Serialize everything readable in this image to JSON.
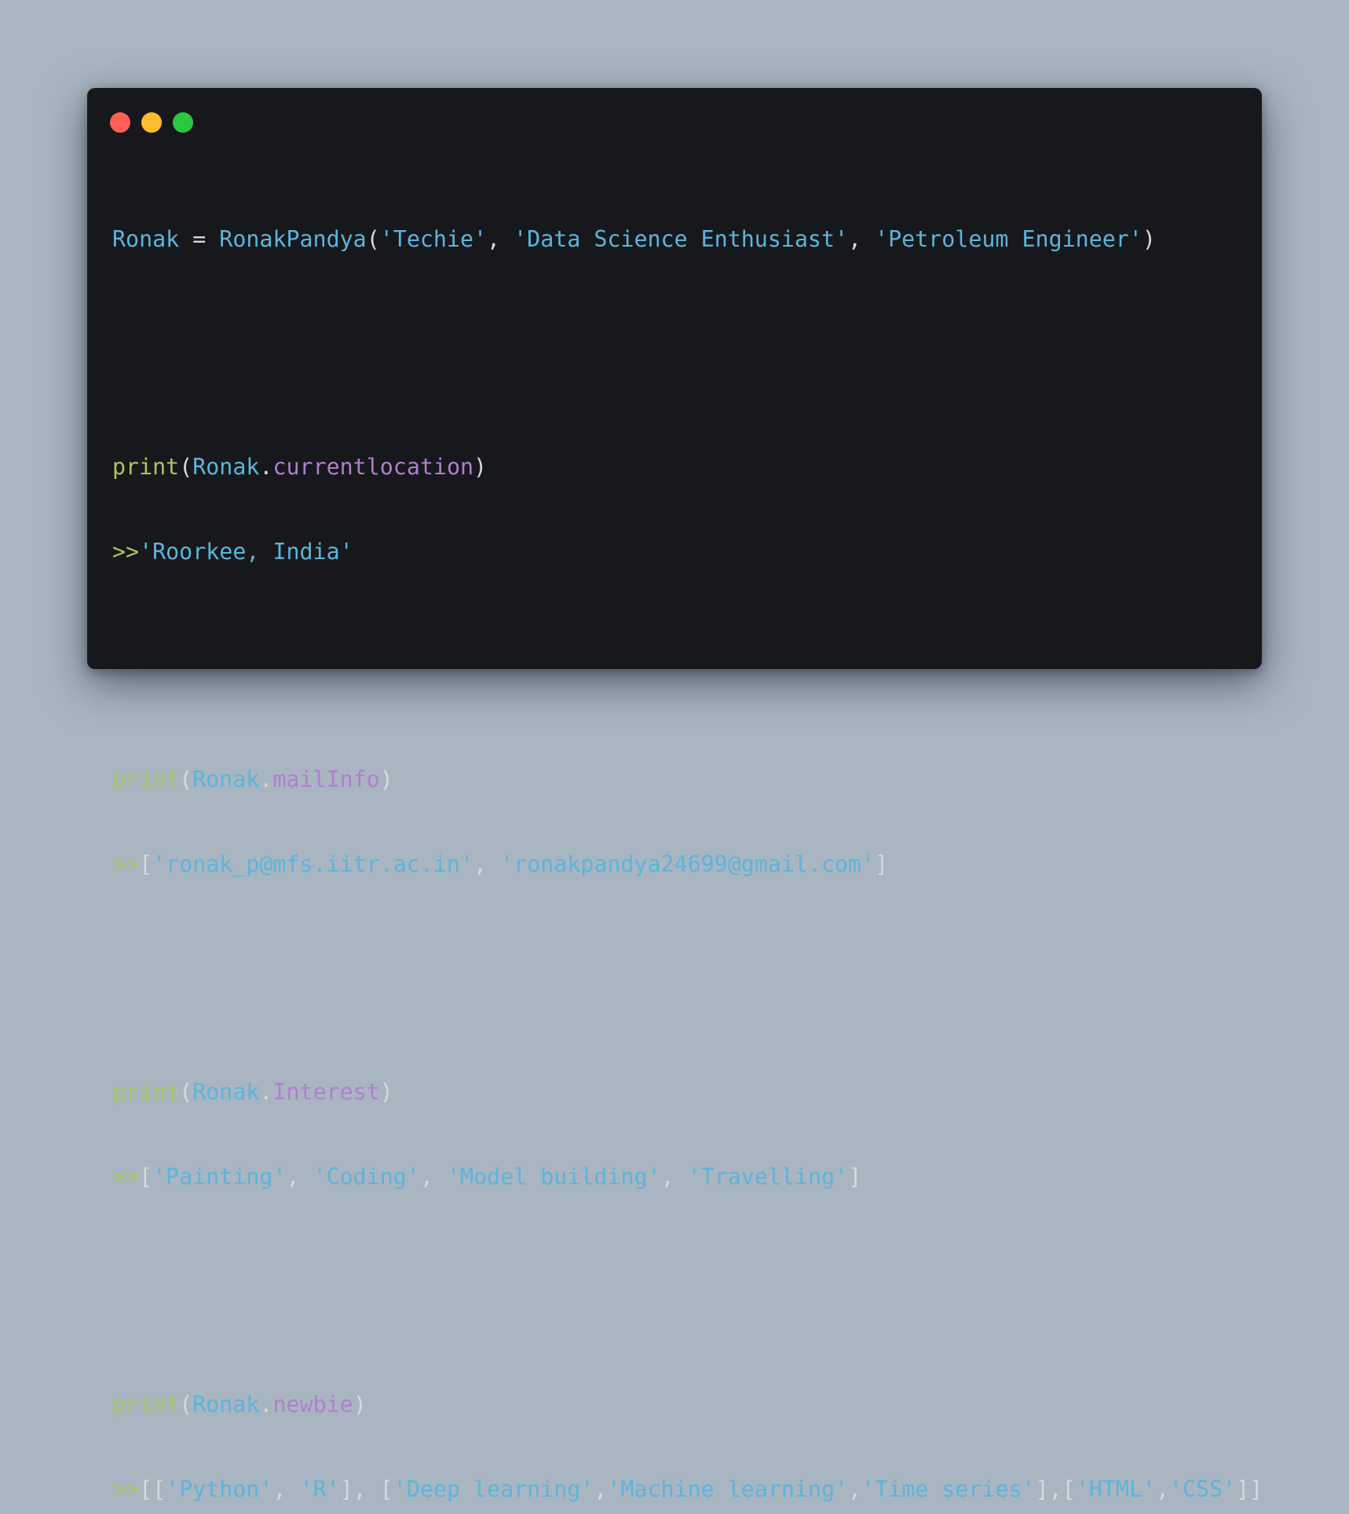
{
  "window": {
    "controls": [
      {
        "name": "close",
        "color": "#fe5f57"
      },
      {
        "name": "minimize",
        "color": "#febc2e"
      },
      {
        "name": "maximize",
        "color": "#28c840"
      }
    ]
  },
  "colors": {
    "function": "#a4c95f",
    "identifier": "#5bb5dc",
    "attribute": "#b07fcf",
    "string": "#5bb5dc",
    "punctuation": "#d6d9dd"
  },
  "code": {
    "line1": {
      "var": "Ronak",
      "op": " = ",
      "cls": "RonakPandya",
      "open": "(",
      "arg1": "'Techie'",
      "sep1": ", ",
      "arg2": "'Data Science Enthusiast'",
      "sep2": ", ",
      "arg3": "'Petroleum Engineer'",
      "close": ")"
    },
    "block1": {
      "fn": "print",
      "open": "(",
      "obj": "Ronak",
      "dot": ".",
      "attr": "currentlocation",
      "close": ")",
      "prompt": ">>",
      "output": "'Roorkee, India'"
    },
    "block2": {
      "fn": "print",
      "open": "(",
      "obj": "Ronak",
      "dot": ".",
      "attr": "mailInfo",
      "close": ")",
      "prompt": ">>",
      "lb": "[",
      "s1": "'ronak_p@mfs.iitr.ac.in'",
      "sep": ", ",
      "s2": "'ronakpandya24699@gmail.com'",
      "rb": "]"
    },
    "block3": {
      "fn": "print",
      "open": "(",
      "obj": "Ronak",
      "dot": ".",
      "attr": "Interest",
      "close": ")",
      "prompt": ">>",
      "lb": "[",
      "s1": "'Painting'",
      "sep1": ", ",
      "s2": "'Coding'",
      "sep2": ", ",
      "s3": "'Model building'",
      "sep3": ", ",
      "s4": "'Travelling'",
      "rb": "]"
    },
    "block4": {
      "fn": "print",
      "open": "(",
      "obj": "Ronak",
      "dot": ".",
      "attr": "newbie",
      "close": ")",
      "prompt": ">>",
      "p1": "[[",
      "s1": "'Python'",
      "p2": ", ",
      "s2": "'R'",
      "p3": "], [",
      "s3": "'Deep learning'",
      "p4": ",",
      "s4": "'Machine learning'",
      "p5": ",",
      "s5": "'Time series'",
      "p6": "],[",
      "s6": "'HTML'",
      "p7": ",",
      "s7": "'CSS'",
      "p8": "]]"
    }
  }
}
